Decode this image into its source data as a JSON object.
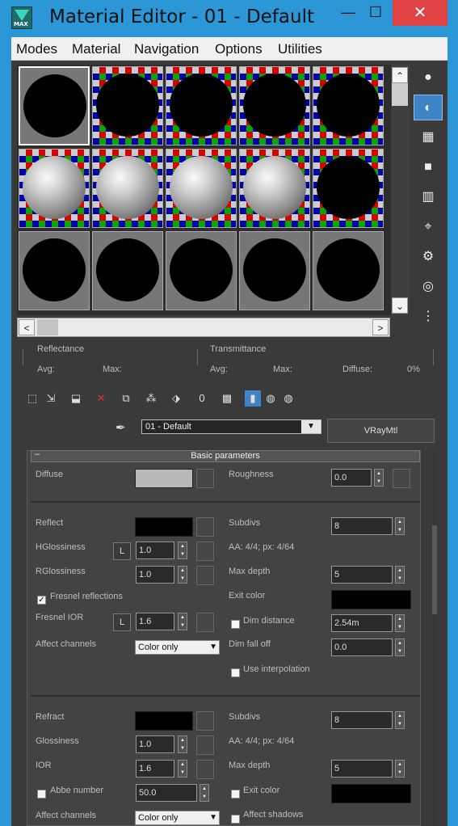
{
  "window": {
    "title": "Material Editor - 01 - Default",
    "app_icon": "3ds-max-icon",
    "app_icon_text": "MAX",
    "min_glyph": "—",
    "max_glyph": "☐",
    "close_glyph": "✕"
  },
  "menu": [
    "Modes",
    "Material",
    "Navigation",
    "Options",
    "Utilities"
  ],
  "slots": [
    {
      "bg": "grey",
      "sphere": "black",
      "active": true
    },
    {
      "bg": "checker",
      "sphere": "black"
    },
    {
      "bg": "checker",
      "sphere": "black"
    },
    {
      "bg": "checker",
      "sphere": "black"
    },
    {
      "bg": "checker",
      "sphere": "black"
    },
    {
      "bg": "checker",
      "sphere": "grey"
    },
    {
      "bg": "checker",
      "sphere": "grey"
    },
    {
      "bg": "checker",
      "sphere": "grey"
    },
    {
      "bg": "checker",
      "sphere": "grey"
    },
    {
      "bg": "checker",
      "sphere": "black"
    },
    {
      "bg": "grey",
      "sphere": "black"
    },
    {
      "bg": "grey",
      "sphere": "black"
    },
    {
      "bg": "grey",
      "sphere": "black"
    },
    {
      "bg": "grey",
      "sphere": "black"
    },
    {
      "bg": "grey",
      "sphere": "black"
    }
  ],
  "scroll": {
    "up": "⌃",
    "down": "⌄",
    "left": "<",
    "right": ">"
  },
  "right_tools": [
    {
      "name": "sample-type-icon",
      "glyph": "●"
    },
    {
      "name": "backlight-icon",
      "glyph": "◐",
      "selected": true
    },
    {
      "name": "background-icon",
      "glyph": "▦"
    },
    {
      "name": "sample-uv-tiling-icon",
      "glyph": "■"
    },
    {
      "name": "video-color-check-icon",
      "glyph": "▥"
    },
    {
      "name": "make-preview-icon",
      "glyph": "⌖"
    },
    {
      "name": "options-icon",
      "glyph": "⚙"
    },
    {
      "name": "select-by-material-icon",
      "glyph": "◎"
    },
    {
      "name": "material-map-navigator-icon",
      "glyph": "⋮"
    }
  ],
  "stats": {
    "reflectance_label": "Reflectance",
    "transmittance_label": "Transmittance",
    "avg_label": "Avg:",
    "max_label": "Max:",
    "diffuse_label": "Diffuse:",
    "diffuse_value": "0%"
  },
  "toolbar": [
    {
      "name": "get-material-icon",
      "glyph": "⬚"
    },
    {
      "name": "put-to-scene-icon",
      "glyph": "⇲"
    },
    {
      "name": "assign-to-selection-icon",
      "glyph": "⬓"
    },
    {
      "name": "reset-map-icon",
      "glyph": "✕",
      "color": "#e03030"
    },
    {
      "name": "make-copy-icon",
      "glyph": "⧉"
    },
    {
      "name": "make-unique-icon",
      "glyph": "⁂"
    },
    {
      "name": "put-to-library-icon",
      "glyph": "⬗"
    },
    {
      "name": "material-id-channel-icon",
      "glyph": "0"
    },
    {
      "name": "show-shaded-material-icon",
      "glyph": "▩"
    },
    {
      "name": "show-end-result-icon",
      "glyph": "▮",
      "selected": true
    },
    {
      "name": "go-to-parent-icon",
      "glyph": "◍"
    },
    {
      "name": "go-forward-to-sibling-icon",
      "glyph": "◍"
    }
  ],
  "material": {
    "name": "01 - Default",
    "type": "VRayMtl",
    "eyedropper": "eyedropper-icon"
  },
  "rollout": {
    "minimize": "–",
    "title": "Basic parameters"
  },
  "params": {
    "diffuse_label": "Diffuse",
    "roughness_label": "Roughness",
    "roughness_value": "0.0",
    "reflect_label": "Reflect",
    "subdivs_label": "Subdivs",
    "reflect_subdivs": "8",
    "aa_text": "AA: 4/4; px: 4/64",
    "hgloss_label": "HGlossiness",
    "hgloss_value": "1.0",
    "rgloss_label": "RGlossiness",
    "rgloss_value": "1.0",
    "max_depth_label": "Max depth",
    "reflect_max_depth": "5",
    "fresnel_label": "Fresnel reflections",
    "exit_color_label": "Exit color",
    "fresnel_ior_label": "Fresnel IOR",
    "fresnel_ior_value": "1.6",
    "dim_distance_label": "Dim distance",
    "dim_distance_value": "2.54m",
    "affect_channels_label": "Affect channels",
    "affect_channels_value": "Color only",
    "dim_falloff_label": "Dim fall off",
    "dim_falloff_value": "0.0",
    "use_interp_label": "Use interpolation",
    "lock_label": "L",
    "refract_label": "Refract",
    "refract_subdivs": "8",
    "glossiness_label": "Glossiness",
    "glossiness_value": "1.0",
    "ior_label": "IOR",
    "ior_value": "1.6",
    "refract_max_depth": "5",
    "abbe_label": "Abbe number",
    "abbe_value": "50.0",
    "affect_shadows_label": "Affect shadows",
    "refract_affect_value": "Color only"
  },
  "colors": {
    "title_bar": "#2b97d6",
    "close": "#e04343",
    "diffuse_swatch": "#b8b8b8",
    "reflect_swatch": "#000000",
    "exit_color_swatch": "#000000",
    "refract_swatch": "#000000"
  }
}
